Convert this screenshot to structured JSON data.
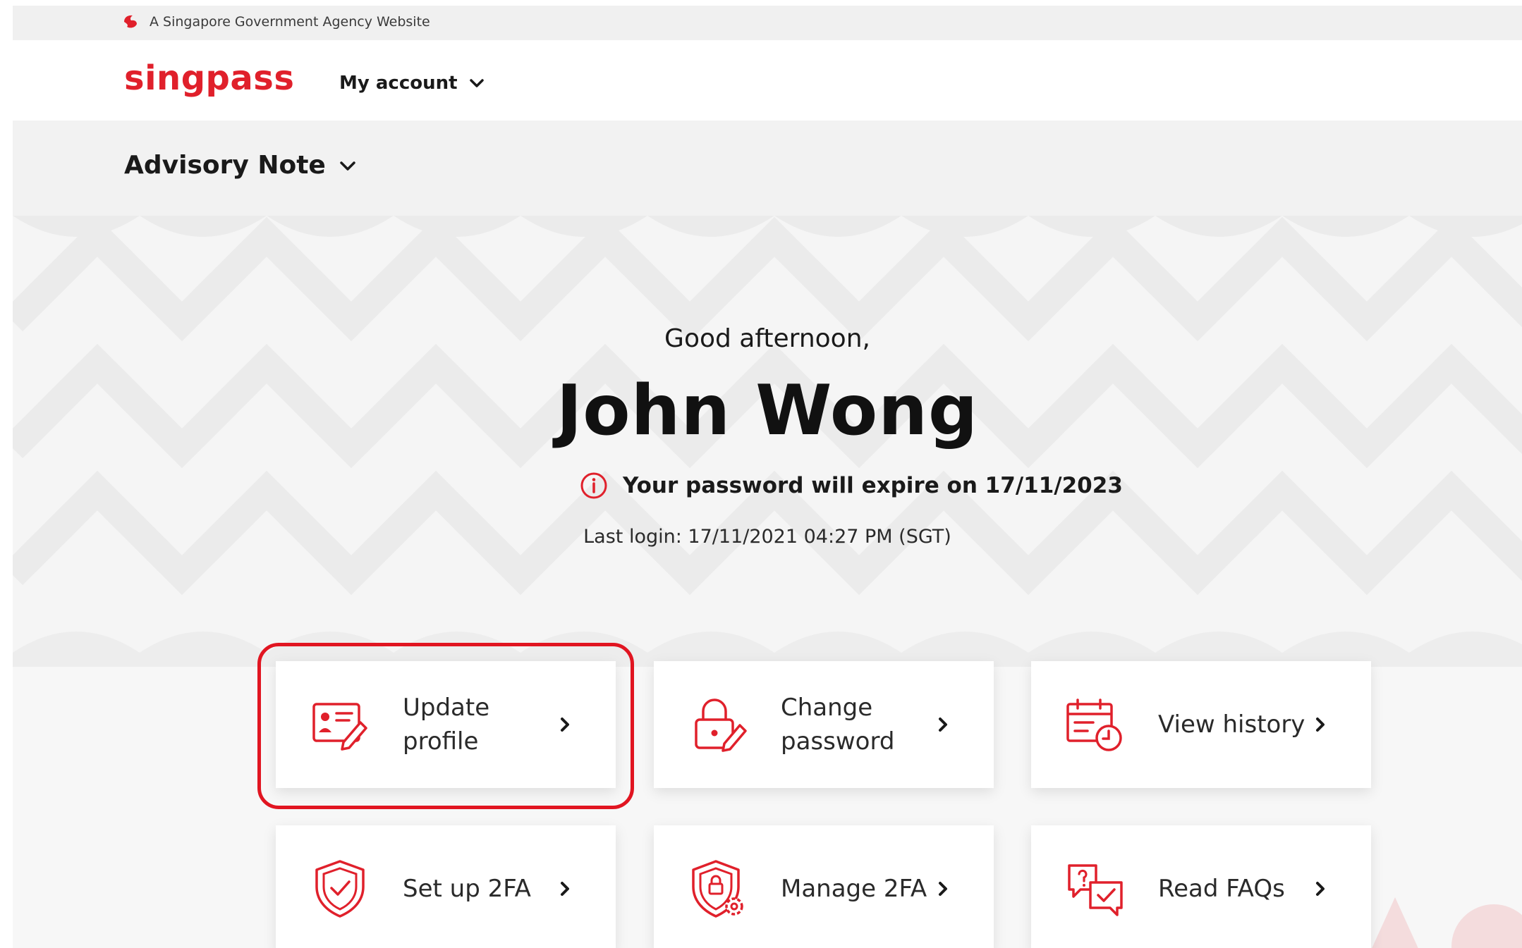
{
  "masthead": {
    "text": "A Singapore Government Agency Website"
  },
  "header": {
    "logo": "singpass",
    "account_label": "My account"
  },
  "advisory": {
    "label": "Advisory Note"
  },
  "greeting": {
    "hello": "Good afternoon,",
    "name": "John Wong",
    "expiry": "Your password will expire on 17/11/2023",
    "last_login": "Last login: 17/11/2021 04:27 PM (SGT)"
  },
  "cards": [
    {
      "label": "Update profile",
      "icon": "profile-edit-icon",
      "highlighted": true
    },
    {
      "label": "Change password",
      "icon": "lock-edit-icon"
    },
    {
      "label": "View history",
      "icon": "calendar-clock-icon"
    },
    {
      "label": "Set up 2FA",
      "icon": "shield-check-icon"
    },
    {
      "label": "Manage 2FA",
      "icon": "shield-gear-icon"
    },
    {
      "label": "Read FAQs",
      "icon": "chat-question-icon"
    }
  ],
  "colors": {
    "brand": "#e0202b",
    "highlight": "#e11521",
    "text": "#1a1a1a"
  }
}
